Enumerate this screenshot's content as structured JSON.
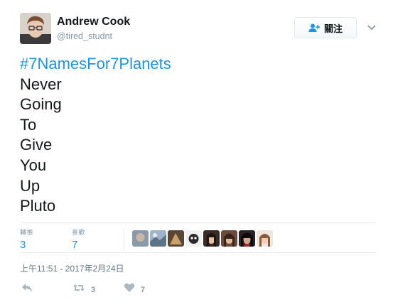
{
  "author": {
    "display_name": "Andrew Cook",
    "screen_name": "@tired_studnt"
  },
  "follow_button": {
    "label": "關注"
  },
  "tweet": {
    "hashtag": "#7NamesFor7Planets",
    "lines": [
      "Never",
      "Going",
      "To",
      "Give",
      "You",
      "Up",
      "Pluto"
    ]
  },
  "stats": {
    "retweets_label": "轉推",
    "retweets": "3",
    "likes_label": "喜歡",
    "likes": "7"
  },
  "timestamp": "上午11:51 - 2017年2月24日",
  "actions": {
    "retweet_count": "3",
    "like_count": "7"
  },
  "colors": {
    "link": "#1b95e0",
    "muted": "#8899a6",
    "text": "#14171a"
  },
  "icons": {
    "follow": "follow-person-plus-icon",
    "caret": "chevron-down-icon",
    "reply": "reply-icon",
    "retweet": "retweet-icon",
    "like": "heart-icon"
  }
}
